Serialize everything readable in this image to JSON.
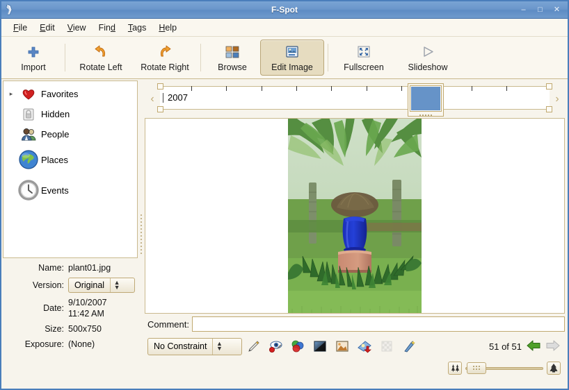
{
  "window": {
    "title": "F-Spot",
    "app_icon": "fspot-logo-icon",
    "controls": {
      "minimize": "–",
      "maximize": "□",
      "close": "✕"
    }
  },
  "menubar": {
    "items": [
      {
        "label": "File",
        "mnemonic": "F"
      },
      {
        "label": "Edit",
        "mnemonic": "E"
      },
      {
        "label": "View",
        "mnemonic": "V"
      },
      {
        "label": "Find",
        "mnemonic": "d"
      },
      {
        "label": "Tags",
        "mnemonic": "T"
      },
      {
        "label": "Help",
        "mnemonic": "H"
      }
    ]
  },
  "toolbar": {
    "items": [
      {
        "label": "Import",
        "icon": "plus-icon",
        "active": false
      },
      {
        "label": "Rotate Left",
        "icon": "rotate-left-icon",
        "active": false
      },
      {
        "label": "Rotate Right",
        "icon": "rotate-right-icon",
        "active": false
      },
      {
        "label": "Browse",
        "icon": "browse-grid-icon",
        "active": false
      },
      {
        "label": "Edit Image",
        "icon": "edit-image-icon",
        "active": true
      },
      {
        "label": "Fullscreen",
        "icon": "fullscreen-icon",
        "active": false
      },
      {
        "label": "Slideshow",
        "icon": "slideshow-play-icon",
        "active": false
      }
    ]
  },
  "sidebar": {
    "tags": [
      {
        "label": "Favorites",
        "icon": "heart-icon",
        "expandable": true
      },
      {
        "label": "Hidden",
        "icon": "padlock-icon",
        "expandable": false
      },
      {
        "label": "People",
        "icon": "people-icon",
        "expandable": false
      },
      {
        "label": "Places",
        "icon": "globe-icon",
        "expandable": false
      },
      {
        "label": "Events",
        "icon": "clock-icon",
        "expandable": false
      }
    ]
  },
  "metadata": {
    "name_label": "Name:",
    "name_value": "plant01.jpg",
    "version_label": "Version:",
    "version_value": "Original",
    "date_label": "Date:",
    "date_value_line1": "9/10/2007",
    "date_value_line2": "11:42 AM",
    "size_label": "Size:",
    "size_value": "500x750",
    "exposure_label": "Exposure:",
    "exposure_value": "(None)"
  },
  "timeline": {
    "year_label": "2007",
    "prev_arrow": "‹",
    "next_arrow": "›",
    "selection_thumb_color": "#6693c8"
  },
  "photo": {
    "alt": "garden-photo-blue-vase-palms"
  },
  "comment": {
    "label": "Comment:",
    "value": "",
    "placeholder": ""
  },
  "edit_tools": {
    "constraint_value": "No Constraint",
    "tools": [
      {
        "name": "straighten-icon",
        "disabled": false
      },
      {
        "name": "red-eye-removal-icon",
        "disabled": false
      },
      {
        "name": "color-adjust-icon",
        "disabled": false
      },
      {
        "name": "desaturate-icon",
        "disabled": false
      },
      {
        "name": "sepia-tone-icon",
        "disabled": false
      },
      {
        "name": "soft-focus-icon",
        "disabled": false
      },
      {
        "name": "crop-transparent-icon",
        "disabled": true
      },
      {
        "name": "auto-color-wand-icon",
        "disabled": false
      }
    ]
  },
  "navigation": {
    "counter": "51 of 51",
    "prev_enabled": true,
    "next_enabled": false
  },
  "zoom": {
    "min_icon": "zoom-out-trees-icon",
    "max_icon": "zoom-in-tree-icon",
    "value_percent": 6
  },
  "colors": {
    "titlebar_blue": "#6b97cb",
    "panel_cream": "#faf7ef",
    "border_tan": "#c9b98e",
    "accent_gold": "#c0a970",
    "active_button": "#e6dcc0"
  }
}
